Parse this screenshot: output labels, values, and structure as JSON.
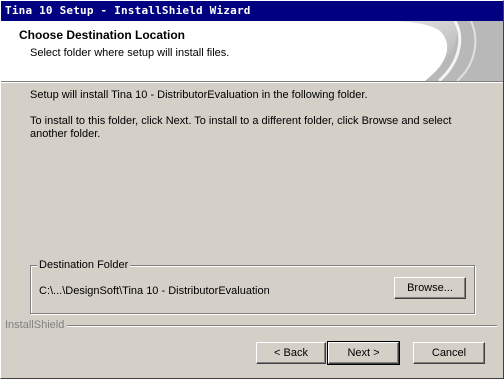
{
  "window": {
    "title": "Tina 10 Setup - InstallShield Wizard"
  },
  "header": {
    "title": "Choose Destination Location",
    "subtitle": "Select folder where setup will install files."
  },
  "body": {
    "line1": "Setup will install Tina 10 - DistributorEvaluation in the following folder.",
    "line2": "To install to this folder, click Next. To install to a different folder, click Browse and select",
    "line3": "another folder."
  },
  "destination": {
    "group_label": "Destination Folder",
    "path": "C:\\...\\DesignSoft\\Tina 10 - DistributorEvaluation",
    "browse_label": "Browse..."
  },
  "footer": {
    "branding": "InstallShield",
    "back_label": "< Back",
    "next_label": "Next >",
    "cancel_label": "Cancel"
  }
}
